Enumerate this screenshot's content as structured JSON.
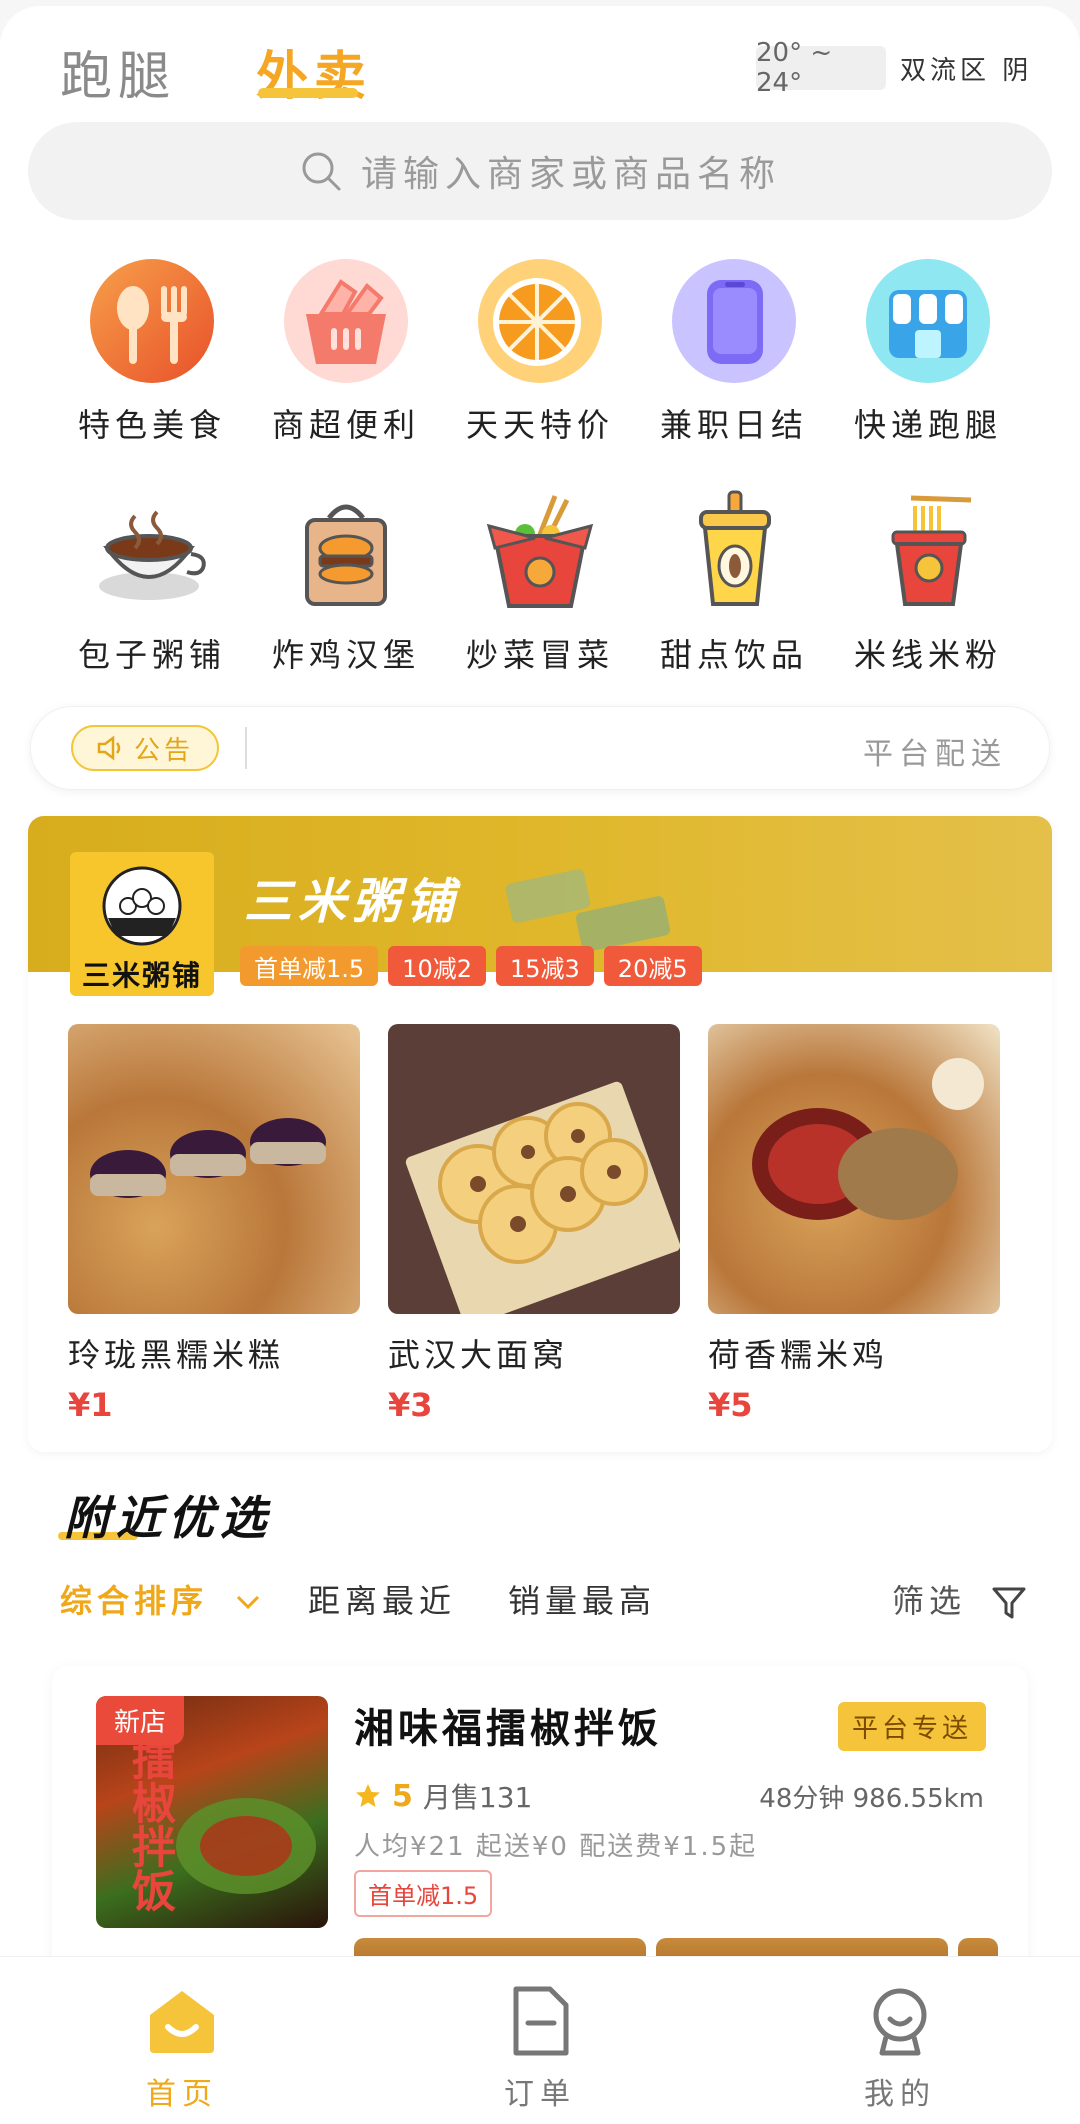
{
  "header": {
    "tabs": [
      {
        "label": "跑腿",
        "active": false
      },
      {
        "label": "外卖",
        "active": true
      }
    ],
    "weather": {
      "temp": "20° ~ 24°",
      "location": "双流区 阴"
    }
  },
  "search": {
    "placeholder": "请输入商家或商品名称"
  },
  "categories": [
    {
      "label": "特色美食",
      "icon": "fork-spoon-icon"
    },
    {
      "label": "商超便利",
      "icon": "basket-icon"
    },
    {
      "label": "天天特价",
      "icon": "orange-icon"
    },
    {
      "label": "兼职日结",
      "icon": "phone-icon"
    },
    {
      "label": "快递跑腿",
      "icon": "storefront-icon"
    },
    {
      "label": "包子粥铺",
      "icon": "porridge-bowl-icon"
    },
    {
      "label": "炸鸡汉堡",
      "icon": "burger-bag-icon"
    },
    {
      "label": "炒菜冒菜",
      "icon": "takeout-box-icon"
    },
    {
      "label": "甜点饮品",
      "icon": "drink-cup-icon"
    },
    {
      "label": "米线米粉",
      "icon": "noodle-cup-icon"
    }
  ],
  "notice": {
    "badge": "公告",
    "right_text": "平台配送"
  },
  "store": {
    "name": "三米粥铺",
    "logo_text": "三米粥铺",
    "tags": [
      "首单减1.5",
      "10减2",
      "15减3",
      "20减5"
    ],
    "products": [
      {
        "name": "玲珑黑糯米糕",
        "price": "¥1"
      },
      {
        "name": "武汉大面窝",
        "price": "¥3"
      },
      {
        "name": "荷香糯米鸡",
        "price": "¥5"
      }
    ]
  },
  "nearby": {
    "title": "附近优选",
    "sorts": [
      "综合排序",
      "距离最近",
      "销量最高"
    ],
    "filter": "筛选"
  },
  "shop": {
    "new_badge": "新店",
    "name": "湘味福擂椒拌饭",
    "badge": "平台专送",
    "score": "5",
    "monthly": "月售131",
    "distance": "48分钟 986.55km",
    "meta": "人均¥21 起送¥0 配送费¥1.5起",
    "coupon": "首单减1.5",
    "img_text": "擂椒拌饭"
  },
  "bottom_nav": [
    {
      "label": "首页",
      "active": true
    },
    {
      "label": "订单",
      "active": false
    },
    {
      "label": "我的",
      "active": false
    }
  ],
  "colors": {
    "accent": "#f0a81b",
    "price": "#e8453c",
    "banner": "#d7ad1d"
  }
}
